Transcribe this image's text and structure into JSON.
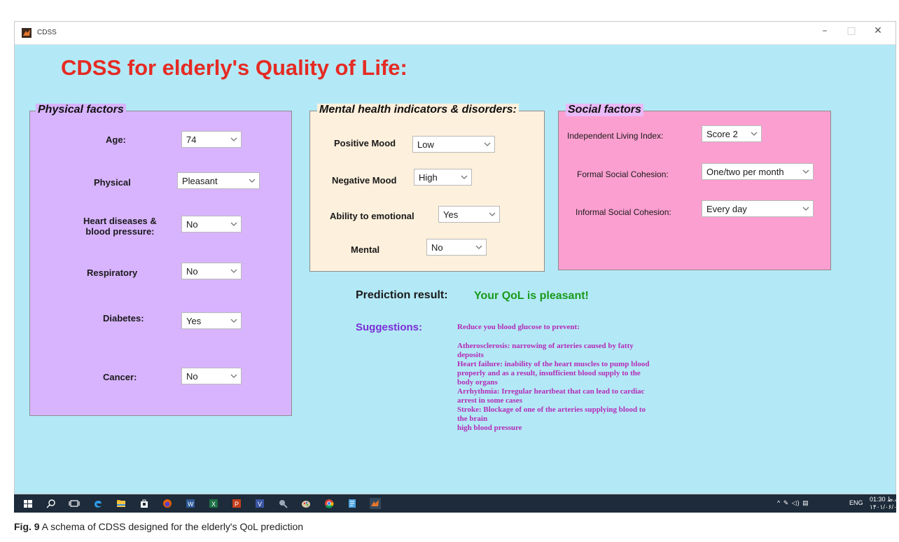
{
  "window": {
    "title": "CDSS",
    "minimize": "–",
    "maximize": "□",
    "close": "✕"
  },
  "app_title": "CDSS for elderly's Quality of Life:",
  "physical": {
    "title": "Physical factors",
    "age": {
      "label": "Age:",
      "value": "74"
    },
    "physical": {
      "label": "Physical",
      "value": "Pleasant"
    },
    "heart": {
      "label_line1": "Heart diseases &",
      "label_line2": "blood pressure:",
      "value": "No"
    },
    "respiratory": {
      "label": "Respiratory",
      "value": "No"
    },
    "diabetes": {
      "label": "Diabetes:",
      "value": "Yes"
    },
    "cancer": {
      "label": "Cancer:",
      "value": "No"
    }
  },
  "mental": {
    "title": "Mental health indicators & disorders:",
    "positive_mood": {
      "label": "Positive Mood",
      "value": "Low"
    },
    "negative_mood": {
      "label": "Negative Mood",
      "value": "High"
    },
    "emotional": {
      "label": "Ability to emotional",
      "value": "Yes"
    },
    "mental": {
      "label": "Mental",
      "value": "No"
    }
  },
  "social": {
    "title": "Social factors",
    "independent": {
      "label": "Independent Living Index:",
      "value": "Score 2"
    },
    "formal": {
      "label": "Formal Social Cohesion:",
      "value": "One/two per month"
    },
    "informal": {
      "label": "Informal Social Cohesion:",
      "value": "Every day"
    }
  },
  "prediction": {
    "label": "Prediction result:",
    "value": "Your QoL is pleasant!"
  },
  "suggestions": {
    "label": "Suggestions:",
    "intro": "Reduce you blood glucose to prevent:",
    "lines": [
      "Atherosclerosis: narrowing of arteries caused by fatty",
      "deposits",
      "Heart failure: inability of the heart muscles to pump blood",
      "properly and as a result, insufficient blood supply to the",
      "body organs",
      "Arrhythmia: Irregular heartbeat that can lead to cardiac",
      "arrest in some cases",
      "Stroke: Blockage of one of the arteries supplying blood to",
      "the brain",
      "high blood pressure"
    ]
  },
  "taskbar": {
    "icons": [
      "start-icon",
      "search-icon",
      "task-view-icon",
      "edge-icon",
      "file-explorer-icon",
      "store-icon",
      "firefox-icon",
      "word-icon",
      "excel-icon",
      "powerpoint-icon",
      "visio-icon",
      "app-icon",
      "paint-icon",
      "chrome-icon",
      "notepad-icon",
      "matlab-icon"
    ],
    "tray_glyphs": "^ ✎ ◁) ▤",
    "lang": "ENG",
    "time": "01:30 ب.ظ",
    "date": "۱۴۰۱/۰۶/۰۳"
  },
  "caption": {
    "label": "Fig. 9",
    "text": " A schema of CDSS designed for the elderly's QoL prediction"
  },
  "colors": {
    "background": "#b3e9f6",
    "physical_panel": "#d8b4fe",
    "mental_panel": "#fdf0dc",
    "social_panel": "#fb9fd0",
    "title_red": "#e52b24",
    "prediction_green": "#1a9a1a",
    "suggestion_purple": "#7a2ed6",
    "suggestion_text": "#b42bb8"
  }
}
